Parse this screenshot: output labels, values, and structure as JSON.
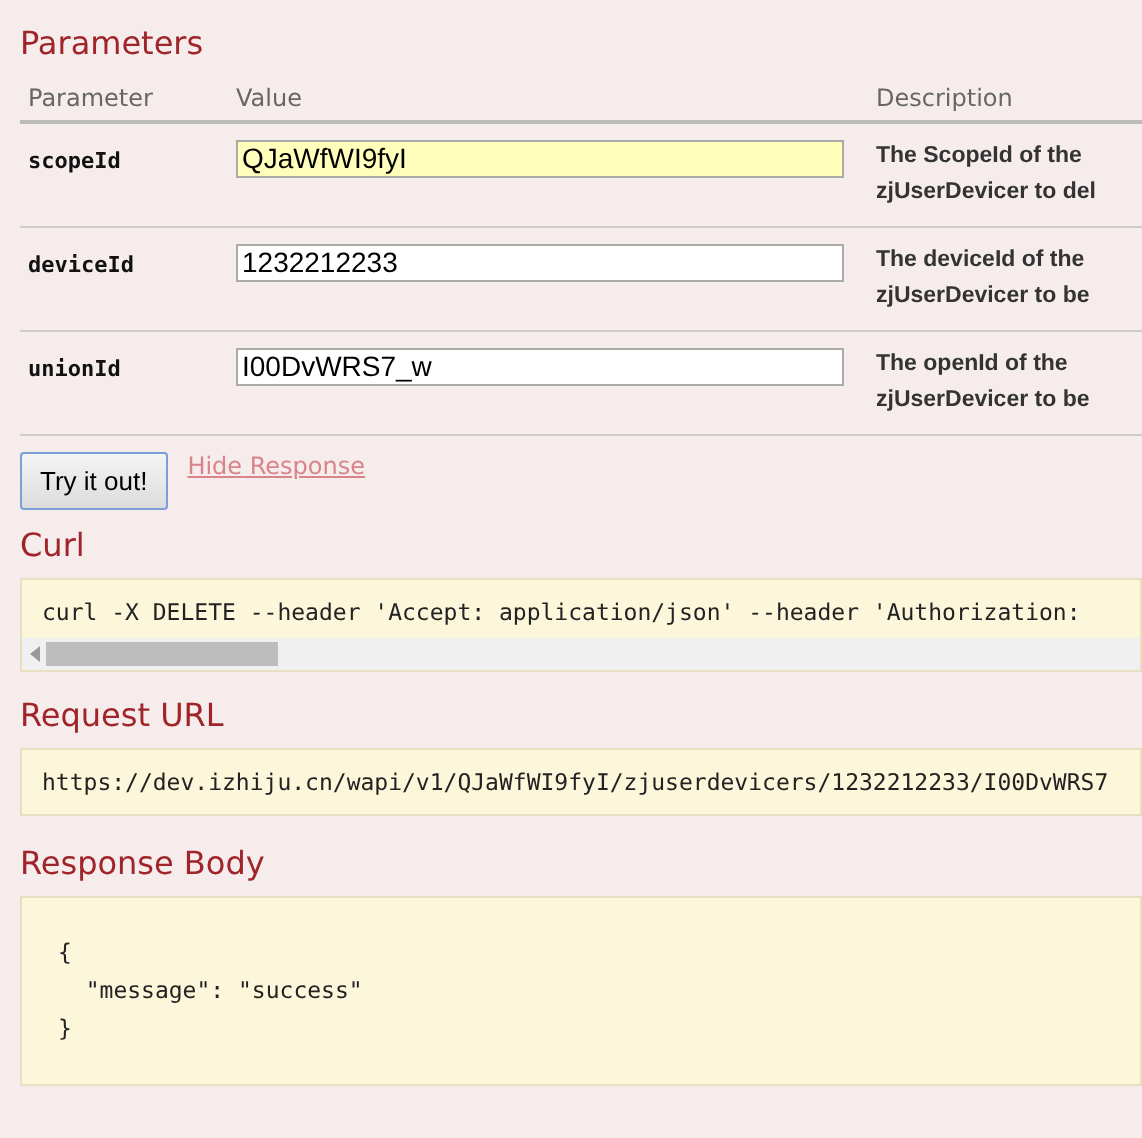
{
  "parameters": {
    "title": "Parameters",
    "columns": [
      "Parameter",
      "Value",
      "Description"
    ],
    "rows": [
      {
        "name": "scopeId",
        "value": "QJaWfWI9fyI",
        "highlighted": true,
        "description": [
          "The ScopeId of the",
          "zjUserDevicer to del"
        ]
      },
      {
        "name": "deviceId",
        "value": "1232212233",
        "highlighted": false,
        "description": [
          "The deviceId of the",
          "zjUserDevicer to be"
        ]
      },
      {
        "name": "unionId",
        "value": "I00DvWRS7_w",
        "highlighted": false,
        "description": [
          "The openId of the",
          "zjUserDevicer to be"
        ]
      }
    ]
  },
  "actions": {
    "button": "Try it out!",
    "link": "Hide Response"
  },
  "curl": {
    "title": "Curl",
    "command": "curl -X DELETE --header 'Accept: application/json' --header 'Authorization:"
  },
  "request_url": {
    "title": "Request URL",
    "url": "https://dev.izhiju.cn/wapi/v1/QJaWfWI9fyI/zjuserdevicers/1232212233/I00DvWRS7"
  },
  "response_body": {
    "title": "Response Body",
    "lines": [
      "{",
      "  \"message\": \"success\"",
      "}"
    ]
  }
}
